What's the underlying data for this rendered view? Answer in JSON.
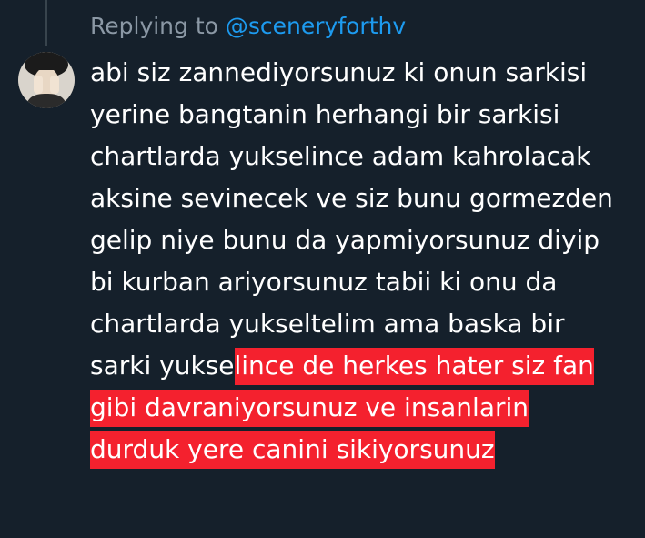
{
  "reply": {
    "prefix": "Replying to ",
    "mention": "@sceneryforthv"
  },
  "avatar": {
    "icon": "user-avatar"
  },
  "tweet": {
    "lines": [
      "abi siz zannediyorsunuz ki onun sarkisi",
      "yerine bangtanin herhangi bir sarkisi",
      "chartlarda yukselince adam kahrolacak",
      "aksine sevinecek ve siz bunu gormezden",
      "gelip niye bunu da yapmiyorsunuz diyip",
      "bi kurban ariyorsunuz tabii ki onu da",
      "chartlarda yukseltelim ama baska bir"
    ],
    "line8_plain": "sarki yukse",
    "line8_highlight": "lince de herkes hater siz fan",
    "line9_highlight": "gibi davraniyorsunuz ve insanlarin",
    "line10_highlight": "durduk yere canini sikiyorsunuz",
    "highlight_color": "#f4212e"
  },
  "colors": {
    "background": "#15202b",
    "muted_text": "#8b98a5",
    "link": "#1d9bf0",
    "thread_line": "#38444d"
  }
}
